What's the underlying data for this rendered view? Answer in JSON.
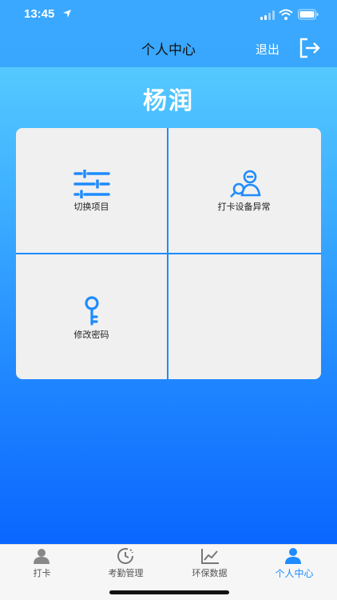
{
  "status_bar": {
    "time": "13:45"
  },
  "header": {
    "title": "个人中心",
    "logout_label": "退出"
  },
  "user": {
    "name": "杨润"
  },
  "grid": {
    "items": [
      {
        "label": "切换项目",
        "icon": "sliders-icon"
      },
      {
        "label": "打卡设备异常",
        "icon": "user-search-icon"
      },
      {
        "label": "修改密码",
        "icon": "key-icon"
      },
      {
        "label": "",
        "icon": ""
      }
    ]
  },
  "tabs": [
    {
      "label": "打卡",
      "icon": "person-icon",
      "active": false
    },
    {
      "label": "考勤管理",
      "icon": "clock-icon",
      "active": false
    },
    {
      "label": "环保数据",
      "icon": "trend-chart-icon",
      "active": false
    },
    {
      "label": "个人中心",
      "icon": "profile-icon",
      "active": true
    }
  ],
  "colors": {
    "accent": "#1e8bff",
    "header": "#39a7fd"
  }
}
